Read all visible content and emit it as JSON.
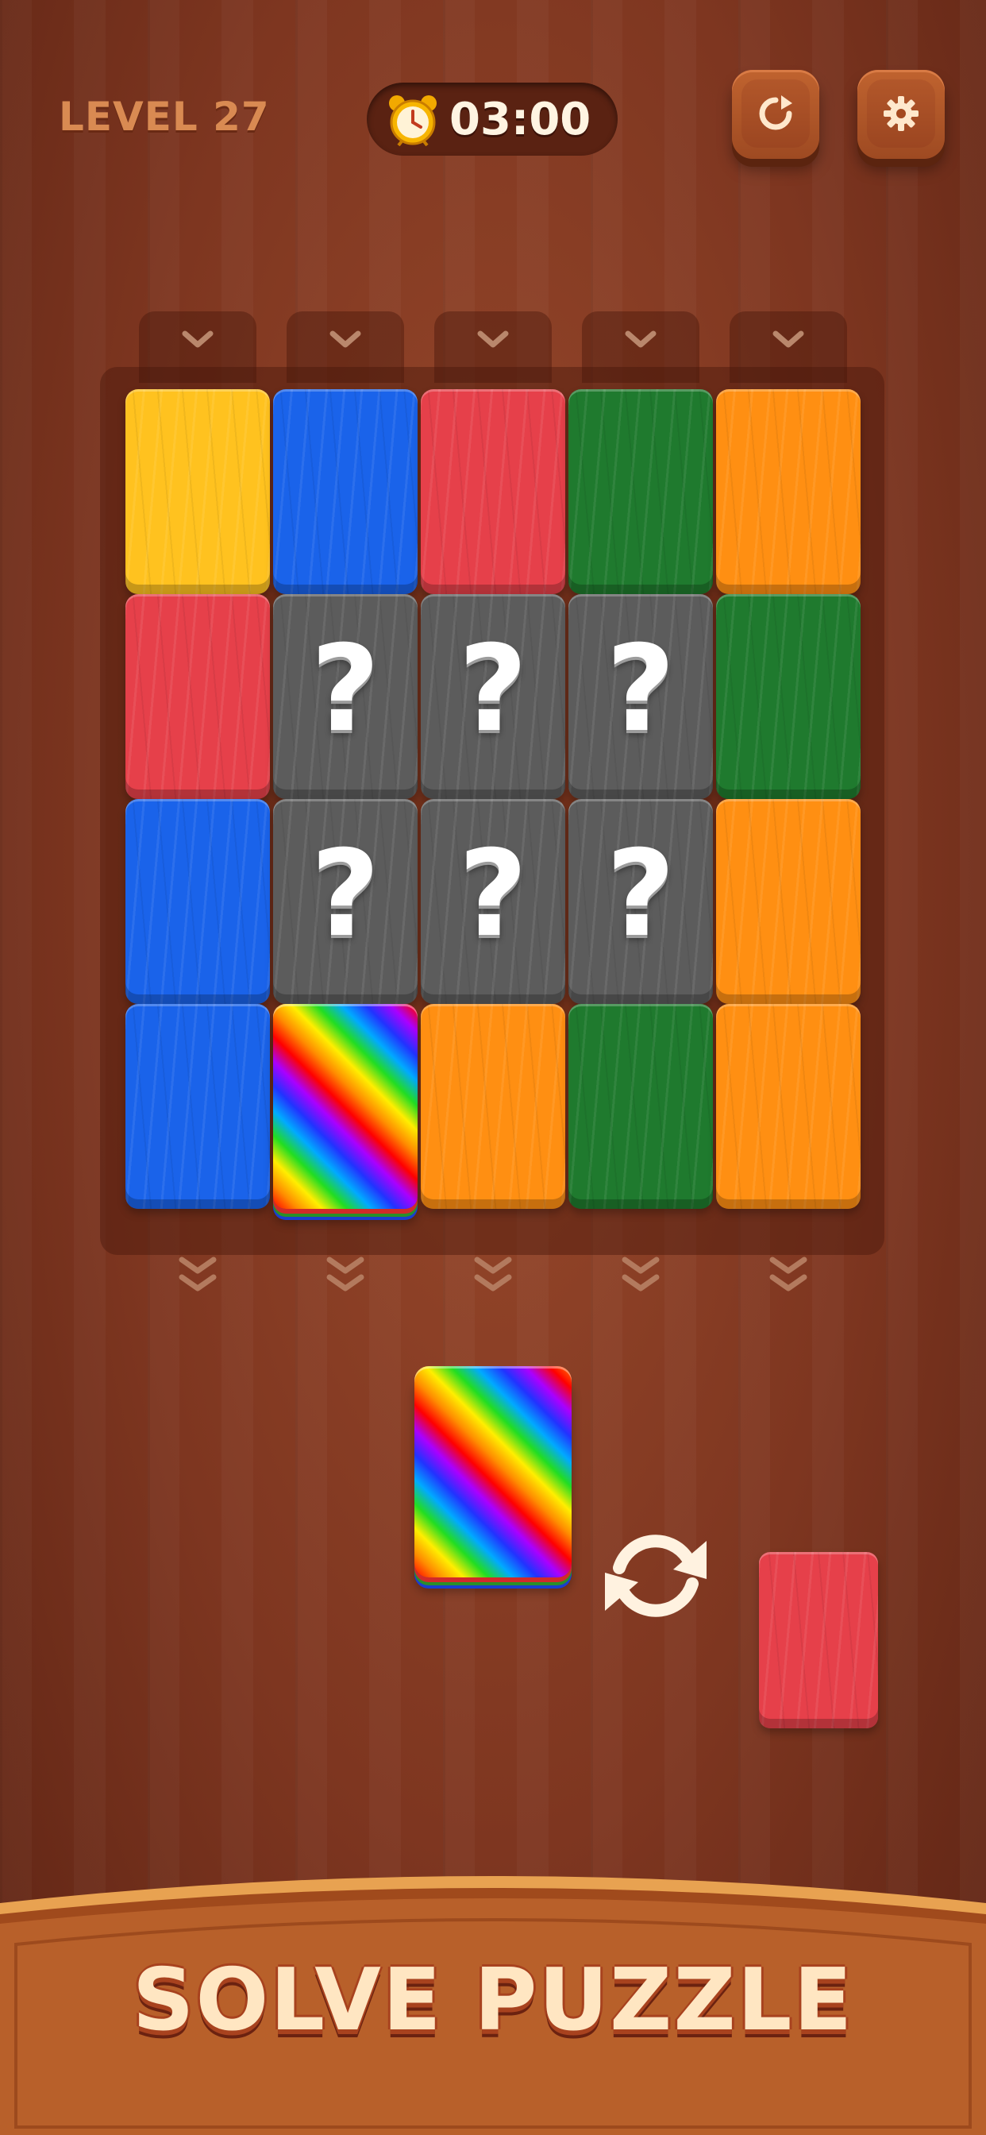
{
  "header": {
    "level_label": "LEVEL 27",
    "timer": "03:00",
    "clock_icon": "alarm-clock-icon",
    "restart_icon": "restart-icon",
    "settings_icon": "gear-icon"
  },
  "colors": {
    "yellow": "#ffc21f",
    "blue": "#1a63ea",
    "red": "#e6404a",
    "green": "#1f7a2e",
    "orange": "#ff8f12",
    "mystery": "#5c5c5c",
    "rainbow": "rainbow"
  },
  "board": {
    "columns": 5,
    "rows": 4,
    "tiles": [
      [
        "yellow",
        "blue",
        "red",
        "green",
        "orange"
      ],
      [
        "red",
        "mystery",
        "mystery",
        "mystery",
        "green"
      ],
      [
        "blue",
        "mystery",
        "mystery",
        "mystery",
        "orange"
      ],
      [
        "blue",
        "rainbow",
        "orange",
        "green",
        "orange"
      ]
    ],
    "mystery_mark": "?"
  },
  "tray": {
    "current_tile": "rainbow",
    "swap_icon": "swap-arrows-icon",
    "next_tile": "red"
  },
  "footer": {
    "title": "SOLVE PUZZLE"
  }
}
